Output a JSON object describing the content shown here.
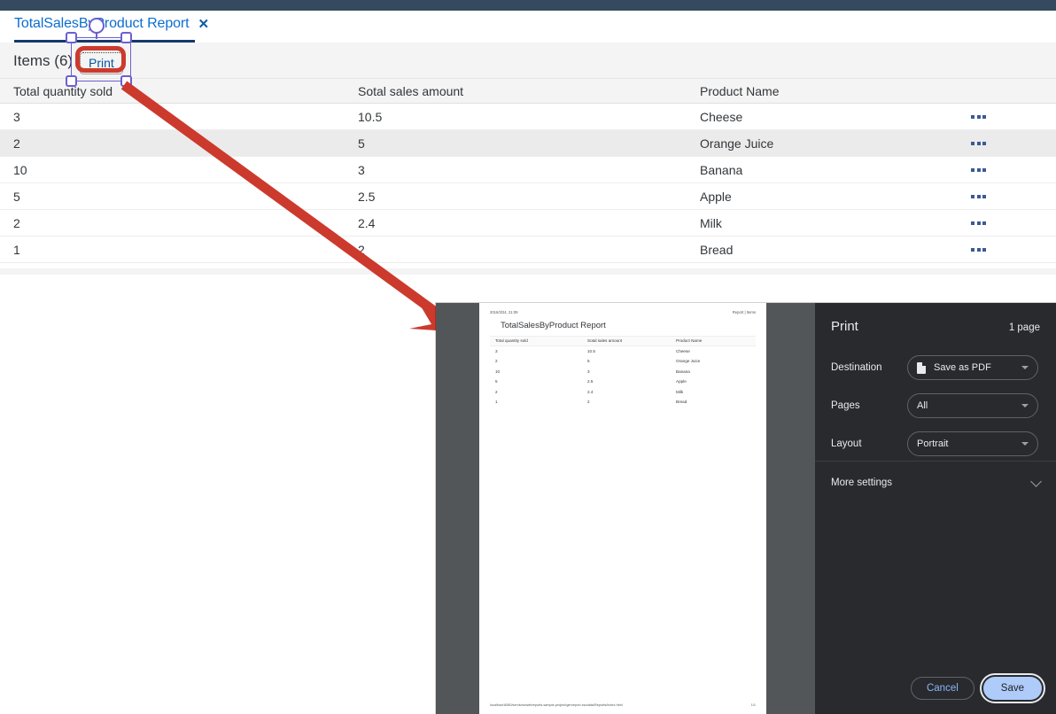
{
  "topbar": {
    "color": "#354a5f"
  },
  "tab": {
    "title": "TotalSalesByProduct Report",
    "close_icon": "✕"
  },
  "toolbar": {
    "items_label": "Items (6)",
    "print_label": "Print"
  },
  "table": {
    "columns": [
      "Total quantity sold",
      "Sotal sales amount",
      "Product Name"
    ],
    "rows": [
      {
        "qty": "3",
        "amount": "10.5",
        "product": "Cheese"
      },
      {
        "qty": "2",
        "amount": "5",
        "product": "Orange Juice"
      },
      {
        "qty": "10",
        "amount": "3",
        "product": "Banana"
      },
      {
        "qty": "5",
        "amount": "2.5",
        "product": "Apple"
      },
      {
        "qty": "2",
        "amount": "2.4",
        "product": "Milk"
      },
      {
        "qty": "1",
        "amount": "2",
        "product": "Bread"
      }
    ]
  },
  "print_preview": {
    "header_left": "2016/3/24, 21:09",
    "header_right": "Report | Items",
    "doc_title": "TotalSalesByProduct Report",
    "footer_left": "localhost:8080/services/webreports.sample-project/genreport.xsodata/Reports/index.html",
    "footer_right": "1/1",
    "columns": [
      "Total quantity sold",
      "Sotal sales amount",
      "Product Name"
    ],
    "rows": [
      {
        "qty": "3",
        "amount": "10.5",
        "product": "Cheese"
      },
      {
        "qty": "2",
        "amount": "5",
        "product": "Orange Juice"
      },
      {
        "qty": "10",
        "amount": "3",
        "product": "Banana"
      },
      {
        "qty": "5",
        "amount": "2.5",
        "product": "Apple"
      },
      {
        "qty": "2",
        "amount": "2.4",
        "product": "Milk"
      },
      {
        "qty": "1",
        "amount": "2",
        "product": "Bread"
      }
    ]
  },
  "print_settings": {
    "title": "Print",
    "page_count": "1 page",
    "destination_label": "Destination",
    "destination_value": "Save as PDF",
    "pages_label": "Pages",
    "pages_value": "All",
    "layout_label": "Layout",
    "layout_value": "Portrait",
    "more_settings_label": "More settings",
    "cancel_label": "Cancel",
    "save_label": "Save"
  },
  "annotation": {
    "highlight_color": "#cc3a2d",
    "selection_color": "#6b5fd0"
  }
}
